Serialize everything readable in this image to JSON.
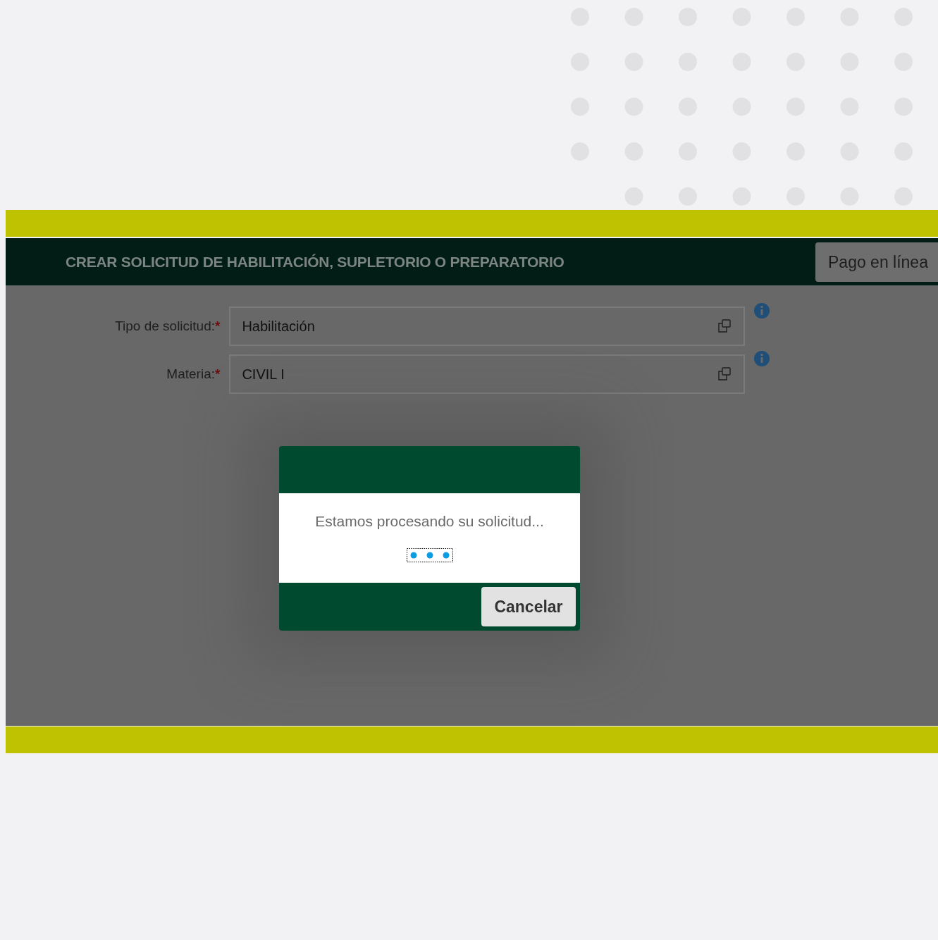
{
  "header": {
    "title": "CREAR SOLICITUD DE HABILITACIÓN, SUPLETORIO O PREPARATORIO",
    "button": "Pago en línea"
  },
  "fields": [
    {
      "label": "Tipo de solicitud:",
      "required_mark": "*",
      "value": "Habilitación"
    },
    {
      "label": "Materia:",
      "required_mark": "*",
      "value": "CIVIL I"
    }
  ],
  "dialog": {
    "message": "Estamos procesando su solicitud...",
    "button": "Cancelar"
  }
}
